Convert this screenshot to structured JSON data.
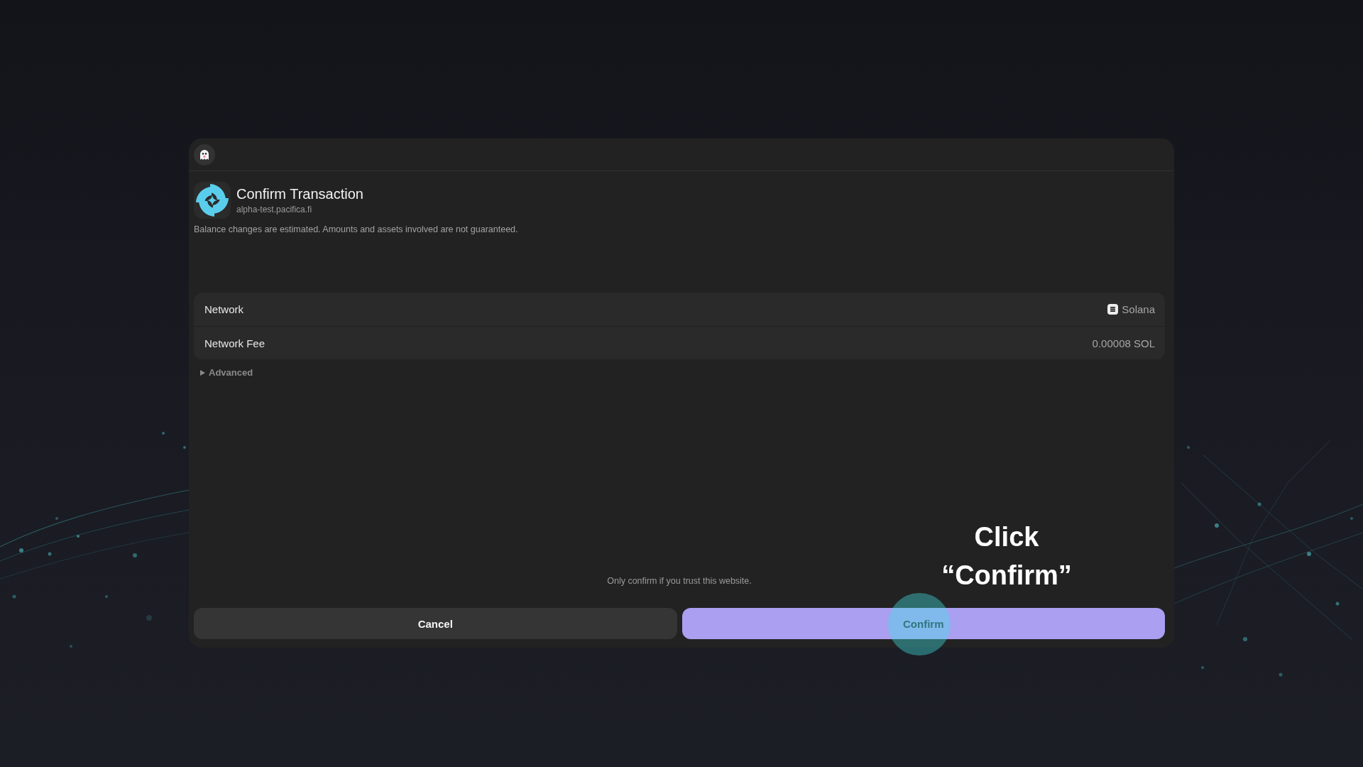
{
  "request": {
    "title": "Confirm Transaction",
    "origin": "alpha-test.pacifica.fi",
    "notice": "Balance changes are estimated. Amounts and assets involved are not guaranteed."
  },
  "details": [
    {
      "kind": "network",
      "label": "Network",
      "value": "Solana"
    },
    {
      "kind": "plain",
      "label": "Network Fee",
      "value": "0.00008 SOL"
    }
  ],
  "advanced": {
    "label": "Advanced",
    "expanded": false
  },
  "warning": "Only confirm if you trust this website.",
  "buttons": [
    {
      "kind": "secondary",
      "label": "Cancel"
    },
    {
      "kind": "primary",
      "label": "Confirm"
    }
  ],
  "callout": {
    "text": "Click “Confirm”"
  }
}
